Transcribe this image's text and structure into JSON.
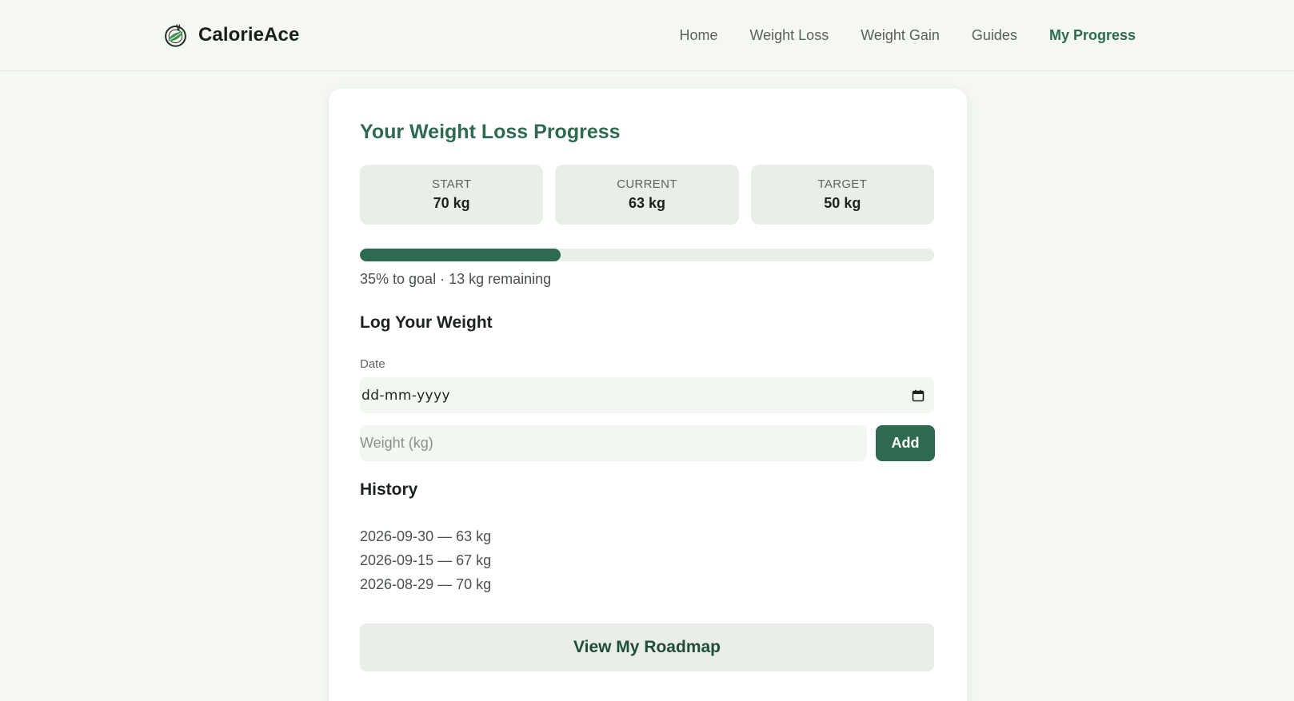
{
  "brand": {
    "name": "CalorieAce",
    "logo_icon": "leaf-plate-icon"
  },
  "nav": {
    "items": [
      {
        "label": "Home"
      },
      {
        "label": "Weight Loss"
      },
      {
        "label": "Weight Gain"
      },
      {
        "label": "Guides"
      },
      {
        "label": "My Progress",
        "active": true
      }
    ]
  },
  "progress": {
    "title": "Your Weight Loss Progress",
    "stats": [
      {
        "label": "START",
        "value": "70 kg"
      },
      {
        "label": "CURRENT",
        "value": "63 kg"
      },
      {
        "label": "TARGET",
        "value": "50 kg"
      }
    ],
    "percent": 35,
    "summary": "35% to goal · 13 kg remaining"
  },
  "log": {
    "title": "Log Your Weight",
    "date_label": "Date",
    "date_placeholder": "dd-mm-yyyy",
    "date_icon": "calendar-icon",
    "weight_placeholder": "Weight (kg)",
    "add_label": "Add"
  },
  "history": {
    "title": "History",
    "entries": [
      "2026-09-30 — 63 kg",
      "2026-09-15 — 67 kg",
      "2026-08-29 — 70 kg"
    ]
  },
  "roadmap_label": "View My Roadmap",
  "colors": {
    "accent": "#2d6a4f",
    "page_bg": "#f4f7f2",
    "tile_bg": "#e9efe8"
  }
}
